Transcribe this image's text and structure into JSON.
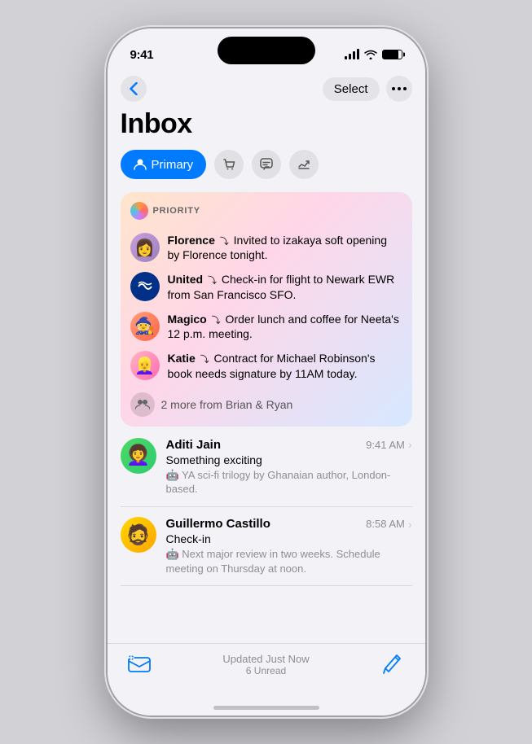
{
  "status": {
    "time": "9:41",
    "signal": [
      3,
      6,
      9,
      12
    ],
    "battery_level": "85"
  },
  "nav": {
    "select_label": "Select",
    "more_icon": "•••"
  },
  "header": {
    "title": "Inbox"
  },
  "tabs": [
    {
      "id": "primary",
      "label": "Primary",
      "icon": "👤",
      "active": true
    },
    {
      "id": "shopping",
      "label": "Shopping",
      "icon": "🛒"
    },
    {
      "id": "messages",
      "label": "Messages",
      "icon": "💬"
    },
    {
      "id": "promotions",
      "label": "Promotions",
      "icon": "📣"
    }
  ],
  "priority": {
    "label": "PRIORITY",
    "items": [
      {
        "sender": "Florence",
        "preview": "Invited to izakaya soft opening by Florence tonight.",
        "avatar_emoji": "👩"
      },
      {
        "sender": "United",
        "preview": "Check-in for flight to Newark EWR from San Francisco SFO.",
        "avatar_emoji": "✈️"
      },
      {
        "sender": "Magico",
        "preview": "Order lunch and coffee for Neeta's 12 p.m. meeting.",
        "avatar_emoji": "🧙"
      },
      {
        "sender": "Katie",
        "preview": "Contract for Michael Robinson's book needs signature by 11AM today.",
        "avatar_emoji": "👱"
      }
    ],
    "more_text": "2 more from Brian & Ryan"
  },
  "emails": [
    {
      "sender": "Aditi Jain",
      "time": "9:41 AM",
      "subject": "Something exciting",
      "preview": "🤖 YA sci-fi trilogy by Ghanaian author, London-based.",
      "avatar_emoji": "👩‍🦱",
      "avatar_class": "avatar-aditi"
    },
    {
      "sender": "Guillermo Castillo",
      "time": "8:58 AM",
      "subject": "Check-in",
      "preview": "🤖 Next major review in two weeks. Schedule meeting on Thursday at noon.",
      "avatar_emoji": "👨‍🦱",
      "avatar_class": "avatar-guillermo"
    }
  ],
  "bottom": {
    "updated_text": "Updated Just Now",
    "unread_text": "6 Unread",
    "compose_icon": "✏️",
    "mailbox_icon": "☰"
  }
}
